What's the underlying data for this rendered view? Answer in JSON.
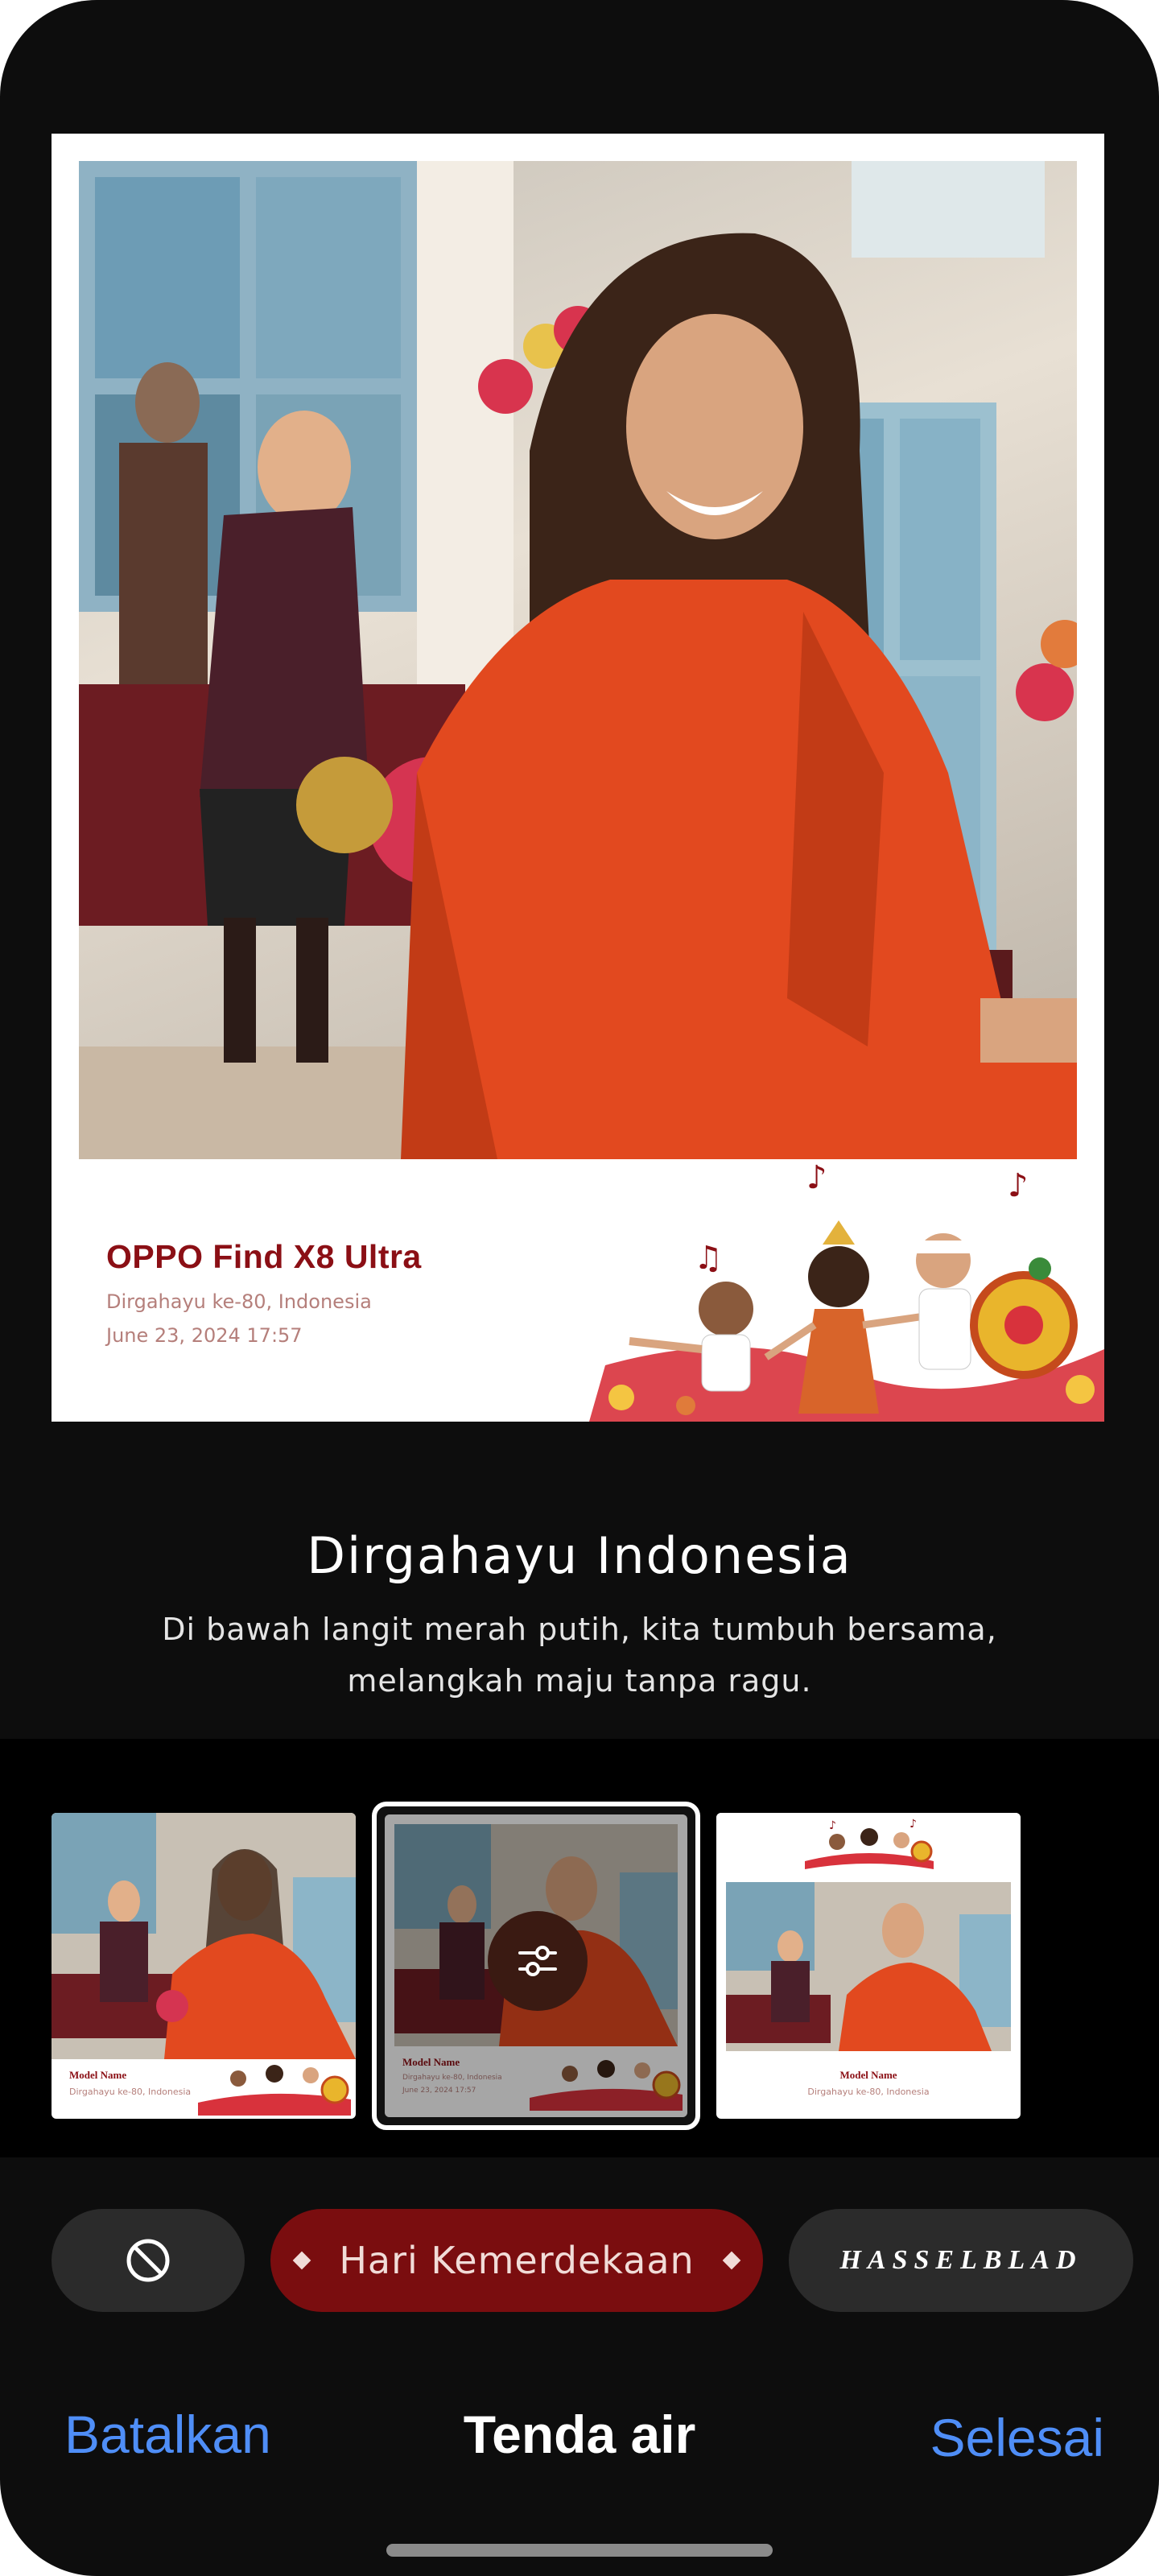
{
  "preview": {
    "model": "OPPO Find X8 Ultra",
    "subtitle": "Dirgahayu ke-80, Indonesia",
    "datetime": "June 23, 2024 17:57"
  },
  "frame": {
    "title": "Dirgahayu Indonesia",
    "description": "Di bawah langit merah putih, kita tumbuh bersama, melangkah maju tanpa ragu."
  },
  "thumbnails": [
    {
      "model": "Model Name",
      "subtitle": "Dirgahayu ke-80, Indonesia"
    },
    {
      "model": "Model Name",
      "subtitle": "Dirgahayu ke-80, Indonesia",
      "datetime": "June 23, 2024 17:57",
      "selected": true
    },
    {
      "model": "Model Name",
      "subtitle": "Dirgahayu ke-80, Indonesia"
    }
  ],
  "chips": {
    "none_icon": "prohibited-icon",
    "theme_label": "Hari Kemerdekaan",
    "brand_label": "HASSELBLAD"
  },
  "bottom_bar": {
    "cancel": "Batalkan",
    "title": "Tenda air",
    "done": "Selesai"
  },
  "colors": {
    "background": "#0d0d0d",
    "accent_red": "#7a0d0f",
    "caption_red": "#8b0f15",
    "link_blue": "#4f8ef7"
  }
}
